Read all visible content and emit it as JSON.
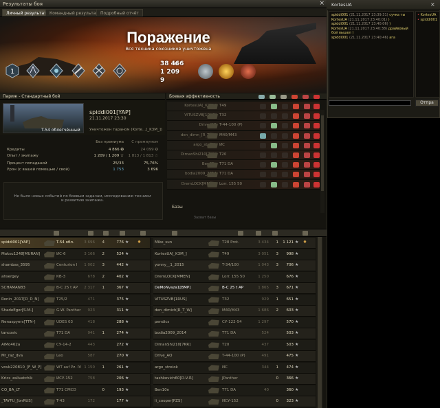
{
  "window": {
    "title": "Результаты боя",
    "close": "×"
  },
  "tabs": [
    "Личный результат",
    "Командный результат",
    "Подробный отчёт"
  ],
  "banner": {
    "result": "Поражение",
    "subtitle": "Вся техника союзников уничтожена",
    "credits": "38 466",
    "xp": "1 209",
    "kills": "9",
    "credit_icon": "star-icon",
    "xp_icon": "star-icon",
    "rank": "1"
  },
  "left": {
    "map": "Париж - Стандартный бой",
    "tank": "T-54 облегчённый",
    "player": "spiddi001[YAP]",
    "date": "21.11.2017 23:30",
    "killed_by": "Уничтожен тараном (Korte...[_K3M_])",
    "col_nopremium": "Без премиума",
    "col_premium": "С премиумом",
    "rows": [
      {
        "label": "Кредиты",
        "a": "4 866 ✪",
        "b": "24 099 ✪"
      },
      {
        "label": "Опыт / экипажу",
        "a": "1 209 / 1 209 ☆",
        "b": "1 813 / 1 813 ☆"
      },
      {
        "label": "Процент попаданий",
        "a": "25/33",
        "b": "75,76%"
      },
      {
        "label": "Урон (с вашей помощью / свой)",
        "a": "1 753",
        "b": "3 696"
      }
    ],
    "task_text": "Не было новых событий по боевым задачам, исследованию техники и развитию экипажа."
  },
  "efficiency": {
    "title": "Боевая эффективность",
    "rows": [
      {
        "name": "KortesUA[_K3M_]",
        "tank": "T49"
      },
      {
        "name": "VITUSZVB[1RUS]",
        "tank": "T32"
      },
      {
        "name": "Drive_AO",
        "tank": "T-44-100 (P)"
      },
      {
        "name": "den_dimn_[R_T_W]",
        "tank": "M40/M43"
      },
      {
        "name": "argo_streiok",
        "tank": "ИС"
      },
      {
        "name": "DimanShi210[7KR]",
        "tank": "T20"
      },
      {
        "name": "Ben10n",
        "tank": "T71 DA"
      },
      {
        "name": "bodia2009_2014",
        "tank": "T71 DA"
      },
      {
        "name": "DremLOCK[MMEN]",
        "tank": "Lorr. 155 50"
      }
    ],
    "bases_label": "Базы",
    "no_bases": "Захват базы"
  },
  "team_left": [
    {
      "name": "spiddi001[YAP]",
      "tank": "T-54 обл.",
      "dmg": "3 696",
      "kills": "4",
      "xp": "776",
      "self": true
    },
    {
      "name": "Maksu1248[MURAN]",
      "tank": "ИС-6",
      "dmg": "3 166",
      "kills": "2",
      "xp": "524"
    },
    {
      "name": "shambas_3595",
      "tank": "Centurion I",
      "dmg": "1 002",
      "kills": "3",
      "xp": "442"
    },
    {
      "name": "ahsergey",
      "tank": "КВ-3",
      "dmg": "678",
      "kills": "2",
      "xp": "402"
    },
    {
      "name": "SCHAMAN83",
      "tank": "B-C 25 t AP",
      "dmg": "2 317",
      "kills": "1",
      "xp": "367"
    },
    {
      "name": "Ronin_2017[D_D_N]",
      "tank": "T25/2",
      "dmg": "471",
      "kills": "",
      "xp": "375"
    },
    {
      "name": "ShadeEgor[S-M-]",
      "tank": "G.W. Panther",
      "dmg": "923",
      "kills": "",
      "xp": "311"
    },
    {
      "name": "Nenaspyers[TTN-]",
      "tank": "UDES 03",
      "dmg": "418",
      "kills": "",
      "xp": "288"
    },
    {
      "name": "tancovic",
      "tank": "T71 DA",
      "dmg": "941",
      "kills": "1",
      "xp": "274"
    },
    {
      "name": "AiMo462a",
      "tank": "СУ-14-2",
      "dmg": "443",
      "kills": "",
      "xp": "272"
    },
    {
      "name": "Mr_raz_dva",
      "tank": "Leo",
      "dmg": "587",
      "kills": "",
      "xp": "270"
    },
    {
      "name": "vovk220810_[F_W_P]",
      "tank": "WT auf Pz. IV",
      "dmg": "1 150",
      "kills": "1",
      "xp": "261"
    },
    {
      "name": "Krics_zalivatchik",
      "tank": "ИСУ-152",
      "dmg": "758",
      "kills": "",
      "xp": "206"
    },
    {
      "name": "CO_BA_LT",
      "tank": "T71 CMCD",
      "dmg": "",
      "kills": "0",
      "xp": "193"
    },
    {
      "name": "_TAYFU_[bnRUS]",
      "tank": "T-43",
      "dmg": "172",
      "kills": "",
      "xp": "177"
    }
  ],
  "team_right": [
    {
      "name": "Mike_sun",
      "tank": "T28 Prot.",
      "dmg": "3 434",
      "kills": "1",
      "xp": "1 121"
    },
    {
      "name": "KortesUA[_K3M_]",
      "tank": "T49",
      "dmg": "3 051",
      "kills": "3",
      "xp": "998"
    },
    {
      "name": "yonny__1_2015",
      "tank": "T-34/100",
      "dmg": "1 043",
      "kills": "3",
      "xp": "706"
    },
    {
      "name": "DremLOCK[MMEN]",
      "tank": "Lorr. 155 50",
      "dmg": "1 250",
      "kills": "",
      "xp": "676"
    },
    {
      "name": "DeMoNvaza1[BMP]",
      "tank": "B-C 25 t AP",
      "dmg": "1 865",
      "kills": "3",
      "xp": "671",
      "bold": true
    },
    {
      "name": "VITUSZVB[1RUS]",
      "tank": "T32",
      "dmg": "929",
      "kills": "1",
      "xp": "651"
    },
    {
      "name": "den_dimich[R_T_W]",
      "tank": "M40/M43",
      "dmg": "1 686",
      "kills": "2",
      "xp": "603"
    },
    {
      "name": "pendics",
      "tank": "СУ-122-54",
      "dmg": "1 297",
      "kills": "",
      "xp": "570"
    },
    {
      "name": "bodia2009_2014",
      "tank": "T71 DA",
      "dmg": "524",
      "kills": "",
      "xp": "503"
    },
    {
      "name": "DimanShi210[7KR]",
      "tank": "T20",
      "dmg": "437",
      "kills": "",
      "xp": "503"
    },
    {
      "name": "Drive_AO",
      "tank": "T-44-100 (P)",
      "dmg": "491",
      "kills": "",
      "xp": "475"
    },
    {
      "name": "argo_streiok",
      "tank": "ИС",
      "dmg": "344",
      "kills": "1",
      "xp": "474"
    },
    {
      "name": "tashkovich60[D-V-R]",
      "tank": "JPanther",
      "dmg": "",
      "kills": "0",
      "xp": "366"
    },
    {
      "name": "Ben10n",
      "tank": "T71 DA",
      "dmg": "40",
      "kills": "",
      "xp": "360"
    },
    {
      "name": "li_cooper[PZS]",
      "tank": "ИСУ-152",
      "dmg": "",
      "kills": "0",
      "xp": "323"
    }
  ],
  "chat": {
    "title": "KortesUA",
    "close": "×",
    "messages": [
      {
        "who": "spiddi001",
        "ts": "(21.11.2017 23:39:31)",
        "text": "сучка ты"
      },
      {
        "who": "KortesUA",
        "ts": "(21.11.2017 23:40:01)",
        "text": ")"
      },
      {
        "who": "spiddi001",
        "ts": "(21.11.2017 23:40:06)",
        "text": ")"
      },
      {
        "who": "KortesUA",
        "ts": "(21.11.2017 23:40:38)",
        "text": "драйвовый"
      },
      {
        "who": "",
        "ts": "",
        "text": "бой вышел )"
      },
      {
        "who": "spiddi001",
        "ts": "(21.11.2017 23:40:46)",
        "text": "ага"
      }
    ],
    "users": [
      "KortesUA",
      "spiddi001"
    ],
    "send_label": "Отпра"
  }
}
